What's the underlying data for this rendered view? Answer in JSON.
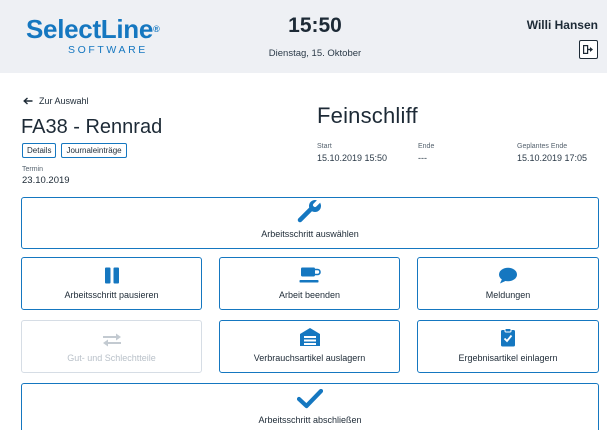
{
  "header": {
    "logo_main": "SelectLine",
    "logo_reg": "®",
    "logo_sub": "SOFTWARE",
    "time": "15:50",
    "date": "Dienstag, 15. Oktober",
    "user": "Willi Hansen",
    "logout_icon": "logout-icon"
  },
  "order": {
    "back_label": "Zur Auswahl",
    "title": "FA38 - Rennrad",
    "tags": [
      "Details",
      "Journaleinträge"
    ],
    "termin_label": "Termin",
    "termin_value": "23.10.2019"
  },
  "step": {
    "title": "Feinschliff",
    "start_label": "Start",
    "start_value": "15.10.2019 15:50",
    "end_label": "Ende",
    "end_value": "---",
    "planned_label": "Geplantes Ende",
    "planned_value": "15.10.2019 17:05"
  },
  "actions": {
    "select_step": "Arbeitsschritt auswählen",
    "pause_step": "Arbeitsschritt pausieren",
    "end_work": "Arbeit beenden",
    "messages": "Meldungen",
    "good_bad_parts": "Gut- und Schlechtteile",
    "consumables": "Verbrauchsartikel auslagern",
    "results": "Ergebnisartikel einlagern",
    "complete_step": "Arbeitsschritt abschließen"
  },
  "colors": {
    "brand": "#1577c0",
    "text": "#1d2a36",
    "header_bg": "#eef0f4",
    "disabled": "#b9c1c9"
  },
  "icons": [
    "wrench-icon",
    "pause-icon",
    "coffee-cup-icon",
    "chat-bubble-icon",
    "swap-arrows-icon",
    "warehouse-icon",
    "clipboard-check-icon",
    "checkmark-icon"
  ]
}
